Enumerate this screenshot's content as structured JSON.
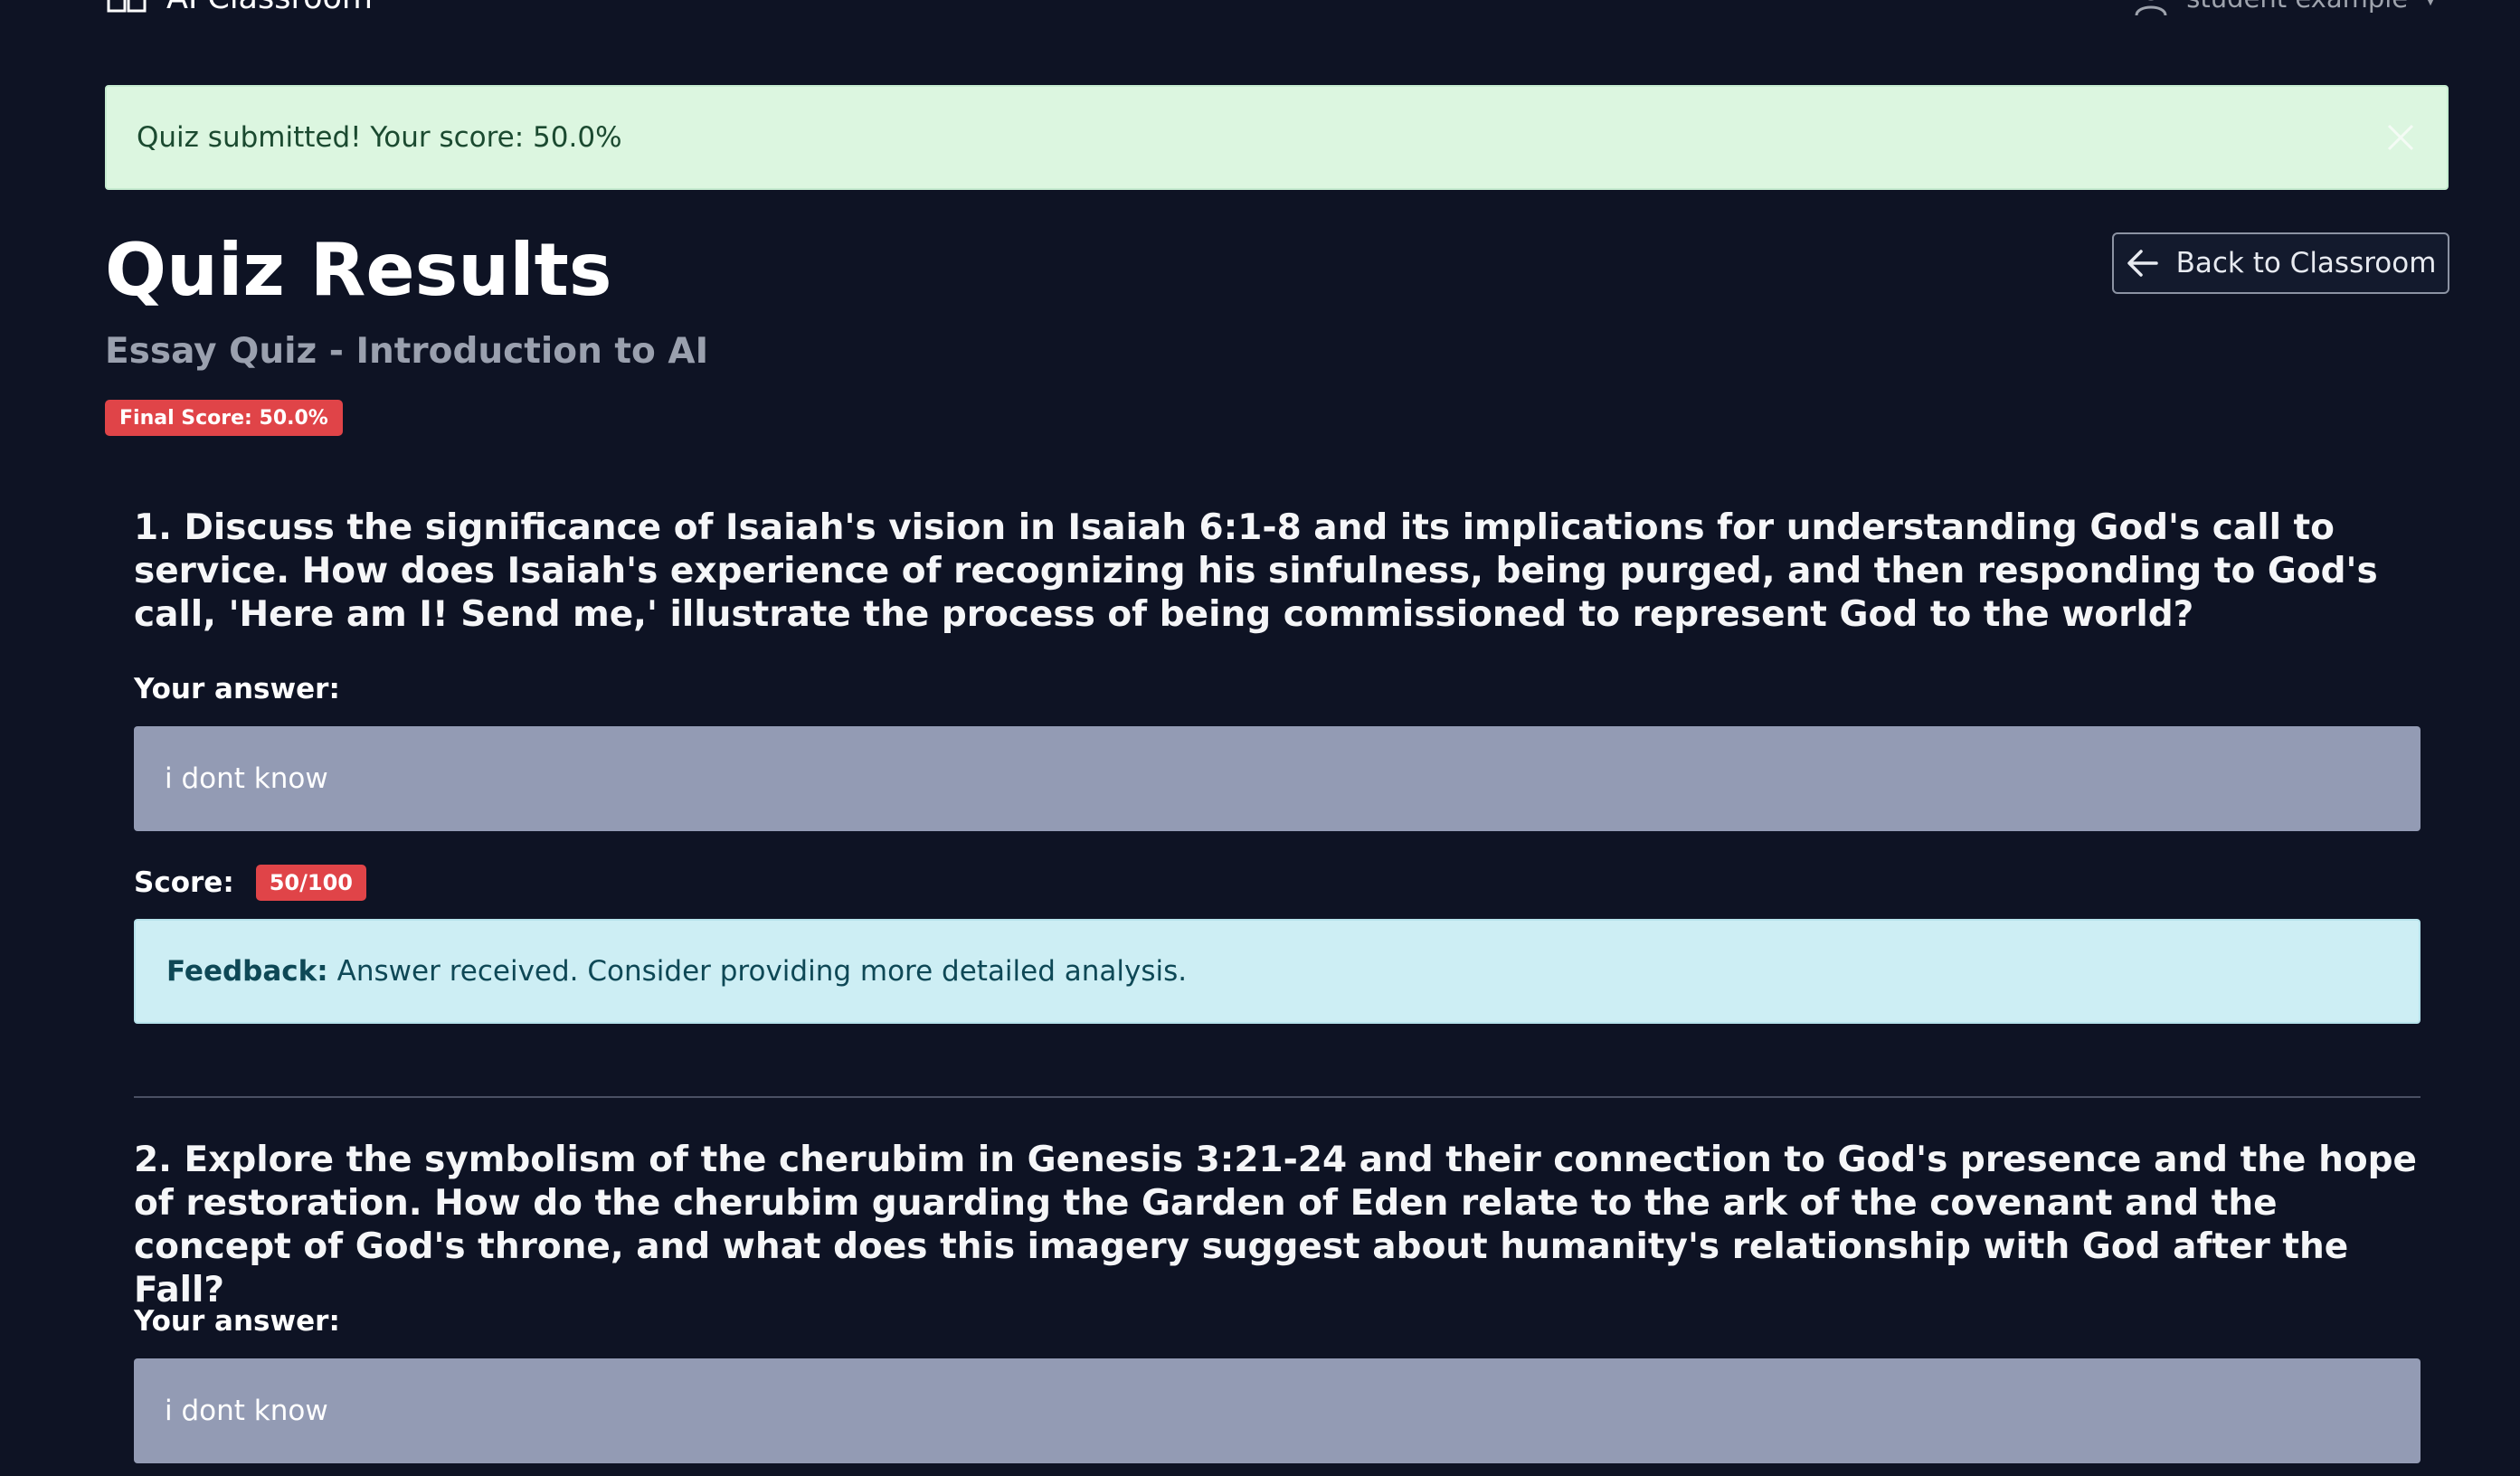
{
  "navbar": {
    "brand": "AI Classroom",
    "user": "student example",
    "brand_icon": "open-book-icon",
    "user_icon": "user-icon"
  },
  "alert": {
    "message": "Quiz submitted! Your score: 50.0%"
  },
  "header": {
    "title": "Quiz Results",
    "subtitle": "Essay Quiz - Introduction to AI",
    "final_score": "Final Score: 50.0%",
    "back_button": "Back to Classroom"
  },
  "labels": {
    "your_answer": "Your answer:",
    "score": "Score:",
    "feedback": "Feedback:"
  },
  "questions": [
    {
      "text": "1. Discuss the significance of Isaiah's vision in Isaiah 6:1-8 and its implications for understanding God's call to service. How does Isaiah's experience of recognizing his sinfulness, being purged, and then responding to God's call, 'Here am I! Send me,' illustrate the process of being commissioned to represent God to the world?",
      "answer": "i dont know",
      "score": "50/100",
      "feedback": "Answer received. Consider providing more detailed analysis."
    },
    {
      "text": "2. Explore the symbolism of the cherubim in Genesis 3:21-24 and their connection to God's presence and the hope of restoration. How do the cherubim guarding the Garden of Eden relate to the ark of the covenant and the concept of God's throne, and what does this imagery suggest about humanity's relationship with God after the Fall?",
      "answer": "i dont know"
    }
  ],
  "colors": {
    "background": "#0e1324",
    "alert_success_bg": "#dcf6e0",
    "danger_badge": "#e04448",
    "answer_box": "#939bb4",
    "feedback_bg": "#cdeef4"
  }
}
